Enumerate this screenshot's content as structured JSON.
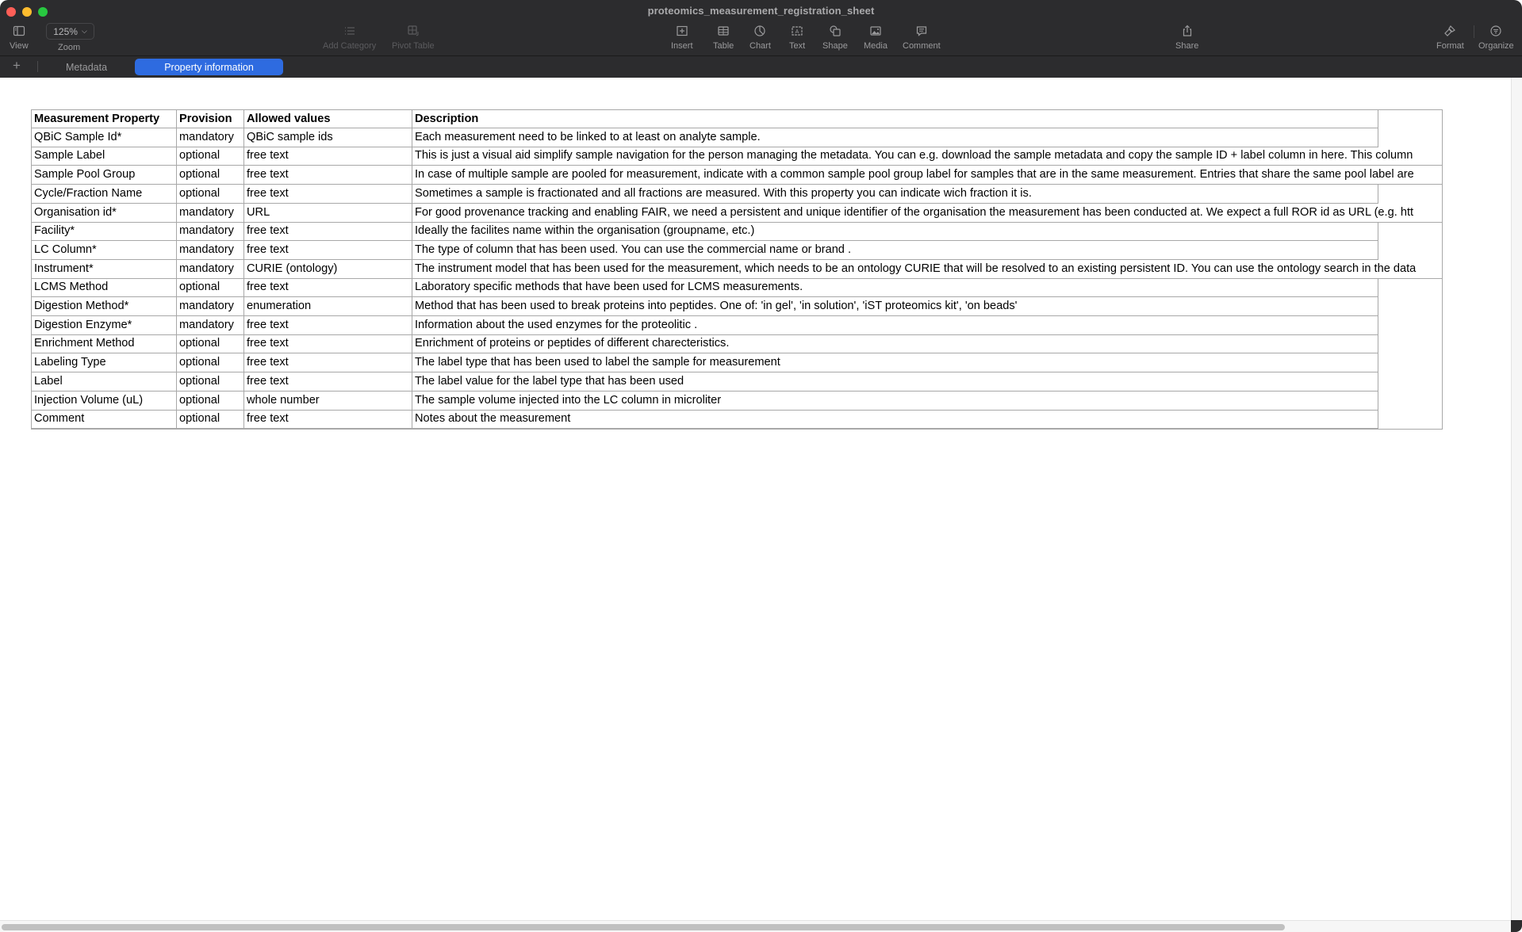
{
  "window": {
    "title": "proteomics_measurement_registration_sheet",
    "traffic_lights": [
      "close",
      "minimize",
      "maximize"
    ]
  },
  "toolbar": {
    "view_label": "View",
    "zoom_value": "125%",
    "zoom_label": "Zoom",
    "add_category_label": "Add Category",
    "pivot_table_label": "Pivot Table",
    "insert_label": "Insert",
    "table_label": "Table",
    "chart_label": "Chart",
    "text_label": "Text",
    "shape_label": "Shape",
    "media_label": "Media",
    "comment_label": "Comment",
    "share_label": "Share",
    "format_label": "Format",
    "organize_label": "Organize"
  },
  "tabs": {
    "add_symbol": "+",
    "items": [
      {
        "label": "Metadata",
        "active": false
      },
      {
        "label": "Property information",
        "active": true
      }
    ],
    "active_color": "#2e6be0"
  },
  "table": {
    "headers": [
      "Measurement Property",
      "Provision",
      "Allowed values",
      "Description"
    ],
    "rows": [
      {
        "property": "QBiC Sample Id*",
        "provision": "mandatory",
        "allowed": "QBiC sample ids",
        "description": "Each measurement need to be linked to at least on analyte sample."
      },
      {
        "property": "Sample Label",
        "provision": "optional",
        "allowed": "free text",
        "description": "This is just a visual aid simplify sample navigation for the person managing the metadata. You can e.g. download the sample metadata and copy the sample ID + label column in here. This column"
      },
      {
        "property": "Sample Pool Group",
        "provision": "optional",
        "allowed": "free text",
        "description": "In case of multiple sample are pooled for measurement, indicate with a common sample pool group label for samples that are in the same measurement. Entries that share the same pool label are"
      },
      {
        "property": "Cycle/Fraction Name",
        "provision": "optional",
        "allowed": "free text",
        "description": "Sometimes a sample is fractionated and all fractions are measured. With this property you can indicate wich fraction it is."
      },
      {
        "property": "Organisation id*",
        "provision": "mandatory",
        "allowed": "URL",
        "description": "For good provenance tracking and enabling FAIR, we need a persistent and unique identifier of the organisation the measurement has been conducted at. We expect a full ROR id as URL (e.g. htt"
      },
      {
        "property": "Facility*",
        "provision": "mandatory",
        "allowed": "free text",
        "description": "Ideally the facilites name within the organisation (groupname, etc.)"
      },
      {
        "property": "LC Column*",
        "provision": "mandatory",
        "allowed": "free text",
        "description": "The type of column that has been used.  You can use the commercial name or brand ."
      },
      {
        "property": "Instrument*",
        "provision": "mandatory",
        "allowed": "CURIE (ontology)",
        "description": "The instrument model that has been used for the measurement, which needs to be an ontology CURIE that will be resolved to an existing persistent ID. You can use the ontology search in the data"
      },
      {
        "property": "LCMS Method",
        "provision": "optional",
        "allowed": "free text",
        "description": "Laboratory specific methods that have been used for LCMS measurements."
      },
      {
        "property": "Digestion Method*",
        "provision": "mandatory",
        "allowed": "enumeration",
        "description": "Method that has been used to break proteins into peptides. One of: 'in gel', 'in solution', 'iST proteomics kit', 'on beads'"
      },
      {
        "property": "Digestion Enzyme*",
        "provision": "mandatory",
        "allowed": "free text",
        "description": "Information about the used enzymes for the proteolitic ."
      },
      {
        "property": "Enrichment Method",
        "provision": "optional",
        "allowed": "free text",
        "description": "Enrichment of proteins or peptides of different charecteristics."
      },
      {
        "property": "Labeling Type",
        "provision": "optional",
        "allowed": "free text",
        "description": "The label type that has been used to label the sample for measurement"
      },
      {
        "property": "Label",
        "provision": "optional",
        "allowed": "free text",
        "description": "The label value for the label type that has been used"
      },
      {
        "property": "Injection Volume (uL)",
        "provision": "optional",
        "allowed": "whole number",
        "description": "The sample volume injected into the LC column in microliter"
      },
      {
        "property": "Comment",
        "provision": "optional",
        "allowed": "free text",
        "description": "Notes about the measurement"
      }
    ],
    "overflowing_rows": [
      1,
      2,
      4,
      7
    ]
  }
}
